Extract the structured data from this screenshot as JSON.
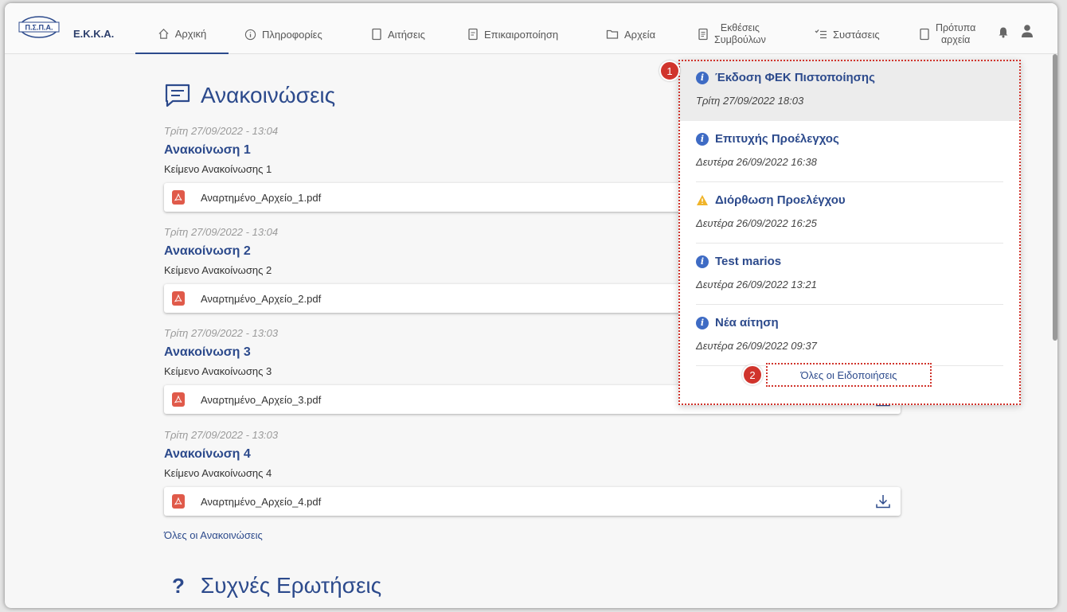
{
  "brand": {
    "name": "Ε.Κ.Κ.Α.",
    "logo_text": "Π.Σ.Π.Α."
  },
  "nav": {
    "items": [
      {
        "label": "Αρχική",
        "icon": "home-icon",
        "active": true
      },
      {
        "label": "Πληροφορίες",
        "icon": "info-icon"
      },
      {
        "label": "Αιτήσεις",
        "icon": "document-icon"
      },
      {
        "label": "Επικαιροποίηση",
        "icon": "edit-document-icon"
      },
      {
        "label": "Αρχεία",
        "icon": "folder-icon"
      },
      {
        "label": [
          "Εκθέσεις",
          "Συμβούλων"
        ],
        "icon": "report-icon"
      },
      {
        "label": "Συστάσεις",
        "icon": "checklist-icon"
      },
      {
        "label": [
          "Πρότυπα",
          "αρχεία"
        ],
        "icon": "file-icon"
      }
    ],
    "bell_icon": "bell-icon",
    "user_icon": "user-icon"
  },
  "announcements": {
    "title": "Ανακοινώσεις",
    "items": [
      {
        "date": "Τρίτη 27/09/2022 - 13:04",
        "title": "Ανακοίνωση 1",
        "text": "Κείμενο Ανακοίνωσης 1",
        "file": "Αναρτημένο_Αρχείο_1.pdf"
      },
      {
        "date": "Τρίτη 27/09/2022 - 13:04",
        "title": "Ανακοίνωση 2",
        "text": "Κείμενο Ανακοίνωσης 2",
        "file": "Αναρτημένο_Αρχείο_2.pdf"
      },
      {
        "date": "Τρίτη 27/09/2022 - 13:03",
        "title": "Ανακοίνωση 3",
        "text": "Κείμενο Ανακοίνωσης 3",
        "file": "Αναρτημένο_Αρχείο_3.pdf"
      },
      {
        "date": "Τρίτη 27/09/2022 - 13:03",
        "title": "Ανακοίνωση 4",
        "text": "Κείμενο Ανακοίνωσης 4",
        "file": "Αναρτημένο_Αρχείο_4.pdf"
      }
    ],
    "all_link": "Όλες οι Ανακοινώσεις"
  },
  "faq": {
    "mark": "?",
    "title": "Συχνές Ερωτήσεις"
  },
  "notifications": {
    "items": [
      {
        "title": "Έκδοση ΦΕΚ Πιστοποίησης",
        "date": "Τρίτη 27/09/2022 18:03",
        "type": "info"
      },
      {
        "title": "Επιτυχής Προέλεγχος",
        "date": "Δευτέρα 26/09/2022 16:38",
        "type": "info"
      },
      {
        "title": "Διόρθωση Προελέγχου",
        "date": "Δευτέρα 26/09/2022 16:25",
        "type": "warning"
      },
      {
        "title": "Test marios",
        "date": "Δευτέρα 26/09/2022 13:21",
        "type": "info"
      },
      {
        "title": "Νέα αίτηση",
        "date": "Δευτέρα 26/09/2022 09:37",
        "type": "info"
      }
    ],
    "all_link": "Όλες οι Ειδοποιήσεις"
  },
  "callouts": {
    "one": "1",
    "two": "2"
  },
  "colors": {
    "accent": "#2c4a8c",
    "callout": "#d0342c",
    "info": "#3e6bc4",
    "warning": "#f0b429",
    "pdf": "#e05a4a"
  }
}
